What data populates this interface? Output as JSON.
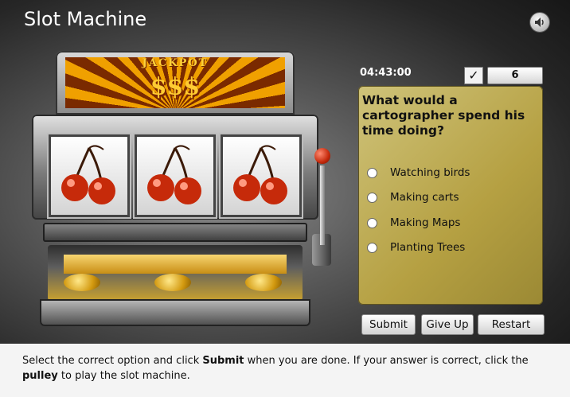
{
  "app": {
    "title": "Slot Machine",
    "sound_icon": "speaker-icon"
  },
  "machine": {
    "marquee_text": "JACKPOT",
    "marquee_symbols": "$$$",
    "reels": [
      {
        "symbol": "cherries"
      },
      {
        "symbol": "cherries"
      },
      {
        "symbol": "cherries"
      }
    ],
    "pulley_icon": "lever-icon"
  },
  "status": {
    "timer": "04:43:00",
    "check_icon": "✓",
    "score": "6"
  },
  "question": {
    "text": "What would a cartographer spend his time doing?",
    "options": [
      {
        "label": "Watching birds",
        "selected": false
      },
      {
        "label": "Making carts",
        "selected": false
      },
      {
        "label": "Making Maps",
        "selected": false
      },
      {
        "label": "Planting Trees",
        "selected": false
      }
    ]
  },
  "buttons": {
    "submit": "Submit",
    "give_up": "Give Up",
    "restart": "Restart"
  },
  "instructions": {
    "part1": "Select the correct option and click ",
    "submit_word": "Submit",
    "part2": " when you are done. If your answer is correct, click the ",
    "pulley_word": "pulley",
    "part3": " to play the slot machine."
  },
  "colors": {
    "panel": "#b5a042",
    "title": "#ffffff",
    "coin": "#d39a10"
  }
}
